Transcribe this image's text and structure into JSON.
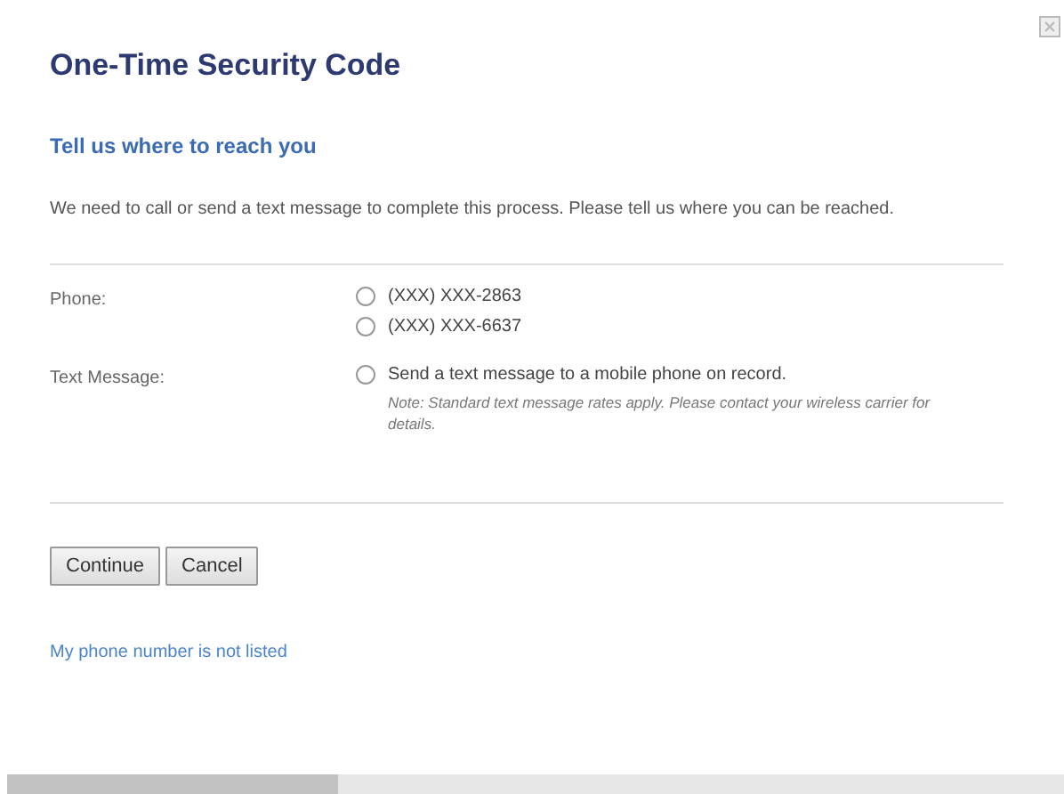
{
  "title": "One-Time Security Code",
  "subtitle": "Tell us where to reach you",
  "intro": "We need to call or send a text message to complete this process. Please tell us where you can be reached.",
  "groups": [
    {
      "label": "Phone:",
      "options": [
        {
          "text": "(XXX) XXX-2863",
          "selected": false
        },
        {
          "text": "(XXX) XXX-6637",
          "selected": false
        }
      ]
    },
    {
      "label": "Text Message:",
      "options": [
        {
          "text": "Send a text message to a mobile phone on record.",
          "selected": false,
          "note": "Note: Standard text message rates apply. Please contact your wireless carrier for details."
        }
      ]
    }
  ],
  "buttons": [
    "Continue",
    "Cancel"
  ],
  "link": "My phone number is not listed"
}
